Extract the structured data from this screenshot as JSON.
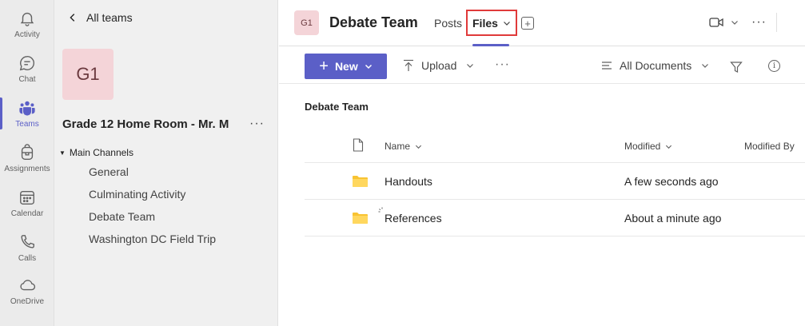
{
  "rail": {
    "items": [
      {
        "label": "Activity",
        "icon": "bell-icon"
      },
      {
        "label": "Chat",
        "icon": "chat-icon"
      },
      {
        "label": "Teams",
        "icon": "teams-icon",
        "active": true
      },
      {
        "label": "Assignments",
        "icon": "backpack-icon"
      },
      {
        "label": "Calendar",
        "icon": "calendar-icon"
      },
      {
        "label": "Calls",
        "icon": "phone-icon"
      },
      {
        "label": "OneDrive",
        "icon": "cloud-icon"
      }
    ]
  },
  "panel": {
    "back_label": "All teams",
    "team_initials": "G1",
    "team_name": "Grade 12 Home Room - Mr. M",
    "more": "···",
    "section": "Main Channels",
    "channels": [
      "General",
      "Culminating Activity",
      "Debate Team",
      "Washington DC Field Trip"
    ]
  },
  "header": {
    "avatar": "G1",
    "title": "Debate Team",
    "tabs": {
      "posts": "Posts",
      "files": "Files"
    },
    "add_tab": "+",
    "more": "···"
  },
  "toolbar": {
    "new_label": "New",
    "upload_label": "Upload",
    "more": "···",
    "view_label": "All Documents"
  },
  "files": {
    "breadcrumb": "Debate Team",
    "columns": {
      "name": "Name",
      "modified": "Modified",
      "modified_by": "Modified By"
    },
    "rows": [
      {
        "name": "Handouts",
        "modified": "A few seconds ago"
      },
      {
        "name": "References",
        "modified": "About a minute ago"
      }
    ]
  },
  "colors": {
    "accent": "#5b5fc7",
    "highlight_box": "#e03a3a",
    "folder": "#f8c332",
    "team_avatar": "#f4d4d8"
  }
}
